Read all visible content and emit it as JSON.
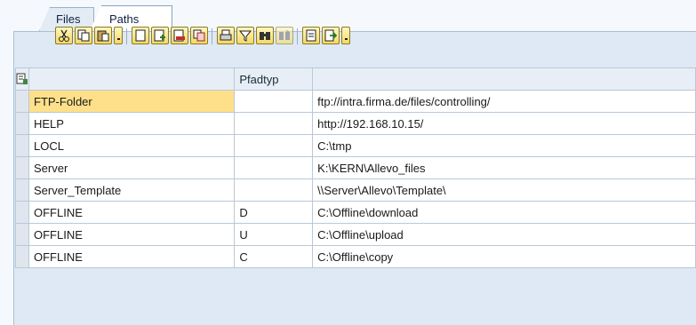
{
  "tabs": [
    {
      "label": "Files",
      "active": false
    },
    {
      "label": "Paths",
      "active": true
    }
  ],
  "toolbar": {
    "buttons": [
      "cut-icon",
      "copy-icon",
      "paste-icon",
      "paste-dropdown",
      "new-row-icon",
      "insert-row-icon",
      "delete-row-icon",
      "copy-row-icon",
      "print-icon",
      "filter-icon",
      "find-icon",
      "find-next-icon",
      "export-icon",
      "export-file-icon",
      "export-dropdown"
    ]
  },
  "table": {
    "headers": {
      "name": "",
      "type": "Pfadtyp",
      "path": ""
    },
    "rows": [
      {
        "name": "FTP-Folder",
        "type": "",
        "path": "ftp://intra.firma.de/files/controlling/"
      },
      {
        "name": "HELP",
        "type": "",
        "path": "http://192.168.10.15/"
      },
      {
        "name": "LOCL",
        "type": "",
        "path": "C:\\tmp"
      },
      {
        "name": "Server",
        "type": "",
        "path": "K:\\KERN\\Allevo_files"
      },
      {
        "name": "Server_Template",
        "type": "",
        "path": "\\\\Server\\Allevo\\Template\\"
      },
      {
        "name": "OFFLINE",
        "type": "D",
        "path": "C:\\Offline\\download"
      },
      {
        "name": "OFFLINE",
        "type": "U",
        "path": "C:\\Offline\\upload"
      },
      {
        "name": "OFFLINE",
        "type": "C",
        "path": "C:\\Offline\\copy"
      }
    ]
  },
  "colors": {
    "highlight": "#ffe08a",
    "panel": "#dfe9f5",
    "button": "#f4d868"
  }
}
